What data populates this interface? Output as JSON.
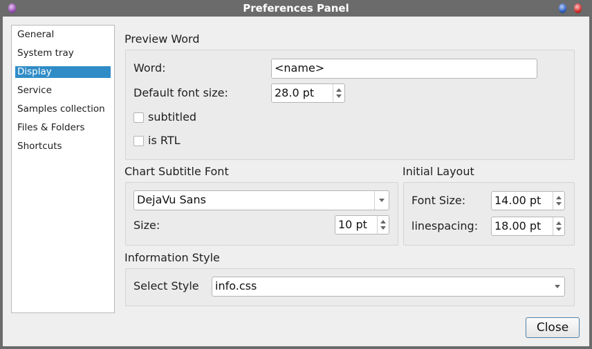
{
  "window": {
    "title": "Preferences Panel",
    "controls": [
      "window-menu",
      "minimize",
      "close"
    ]
  },
  "sidebar": {
    "items": [
      {
        "label": "General",
        "selected": false
      },
      {
        "label": "System tray",
        "selected": false
      },
      {
        "label": "Display",
        "selected": true
      },
      {
        "label": "Service",
        "selected": false
      },
      {
        "label": "Samples collection",
        "selected": false
      },
      {
        "label": "Files & Folders",
        "selected": false
      },
      {
        "label": "Shortcuts",
        "selected": false
      }
    ]
  },
  "preview_word": {
    "title": "Preview Word",
    "word_label": "Word:",
    "word_value": "<name>",
    "font_size_label": "Default font size:",
    "font_size_value": "28.0 pt",
    "subtitled_label": "subtitled",
    "subtitled_checked": false,
    "rtl_label": "is RTL",
    "rtl_checked": false
  },
  "chart_subtitle_font": {
    "title": "Chart Subtitle Font",
    "font_value": "DejaVu Sans",
    "size_label": "Size:",
    "size_value": "10 pt"
  },
  "initial_layout": {
    "title": "Initial Layout",
    "font_size_label": "Font Size:",
    "font_size_value": "14.00 pt",
    "linespacing_label": "linespacing:",
    "linespacing_value": "18.00 pt"
  },
  "information_style": {
    "title": "Information Style",
    "select_label": "Select Style",
    "select_value": "info.css"
  },
  "footer": {
    "close_label": "Close"
  },
  "colors": {
    "selection": "#308cc6",
    "titlebar": "#6b6b6b",
    "window_bg": "#efefef"
  }
}
